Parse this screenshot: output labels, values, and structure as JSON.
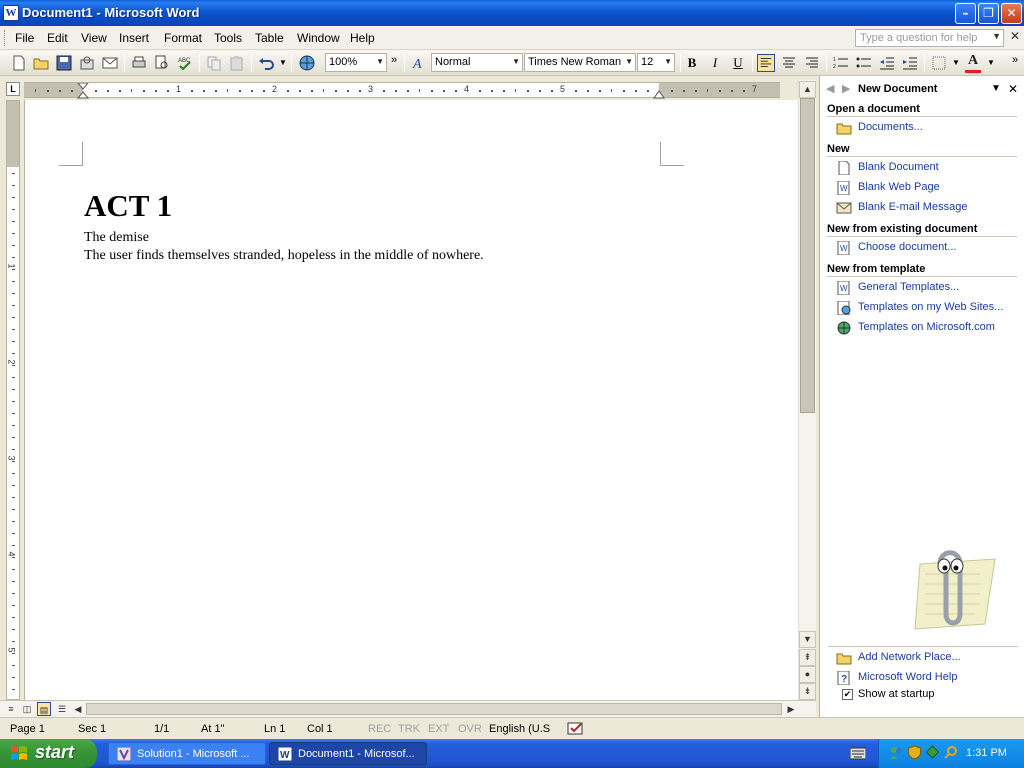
{
  "window": {
    "title": "Document1 - Microsoft Word"
  },
  "menu": {
    "items": [
      "File",
      "Edit",
      "View",
      "Insert",
      "Format",
      "Tools",
      "Table",
      "Window",
      "Help"
    ],
    "help_placeholder": "Type a question for help"
  },
  "toolbar": {
    "zoom": "100%",
    "style": "Normal",
    "font": "Times New Roman",
    "size": "12",
    "bold": "B",
    "italic": "I",
    "underline": "U",
    "font_color_glyph": "A"
  },
  "ruler": {
    "corner": "L",
    "numbers": [
      "1",
      "2",
      "3",
      "4",
      "5",
      "7"
    ],
    "v_numbers": [
      "1",
      "2",
      "3",
      "4",
      "5"
    ]
  },
  "document": {
    "heading": "ACT 1",
    "lines": [
      "The demise",
      "The user finds themselves stranded, hopeless in the middle of nowhere."
    ]
  },
  "task_pane": {
    "title": "New Document",
    "sections": [
      {
        "title": "Open a document",
        "links": [
          "Documents..."
        ]
      },
      {
        "title": "New",
        "links": [
          "Blank Document",
          "Blank Web Page",
          "Blank E-mail Message"
        ]
      },
      {
        "title": "New from existing document",
        "links": [
          "Choose document..."
        ]
      },
      {
        "title": "New from template",
        "links": [
          "General Templates...",
          "Templates on my Web Sites...",
          "Templates on Microsoft.com"
        ]
      }
    ],
    "bottom_links": [
      "Add Network Place...",
      "Microsoft Word Help"
    ],
    "show_at_startup": "Show at startup",
    "show_at_startup_checked": true
  },
  "status_bar": {
    "page": "Page  1",
    "sec": "Sec  1",
    "pages": "1/1",
    "at": "At  1\"",
    "ln": "Ln  1",
    "col": "Col  1",
    "rec": "REC",
    "trk": "TRK",
    "ext": "EXT",
    "ovr": "OVR",
    "language": "English (U.S"
  },
  "taskbar": {
    "start": "start",
    "tasks": [
      "Solution1 - Microsoft ...",
      "Document1 - Microsof..."
    ],
    "clock": "1:31 PM"
  },
  "colors": {
    "link": "#1a3aa0",
    "titlebar": "#0a56d0",
    "start_green": "#3a963a"
  }
}
